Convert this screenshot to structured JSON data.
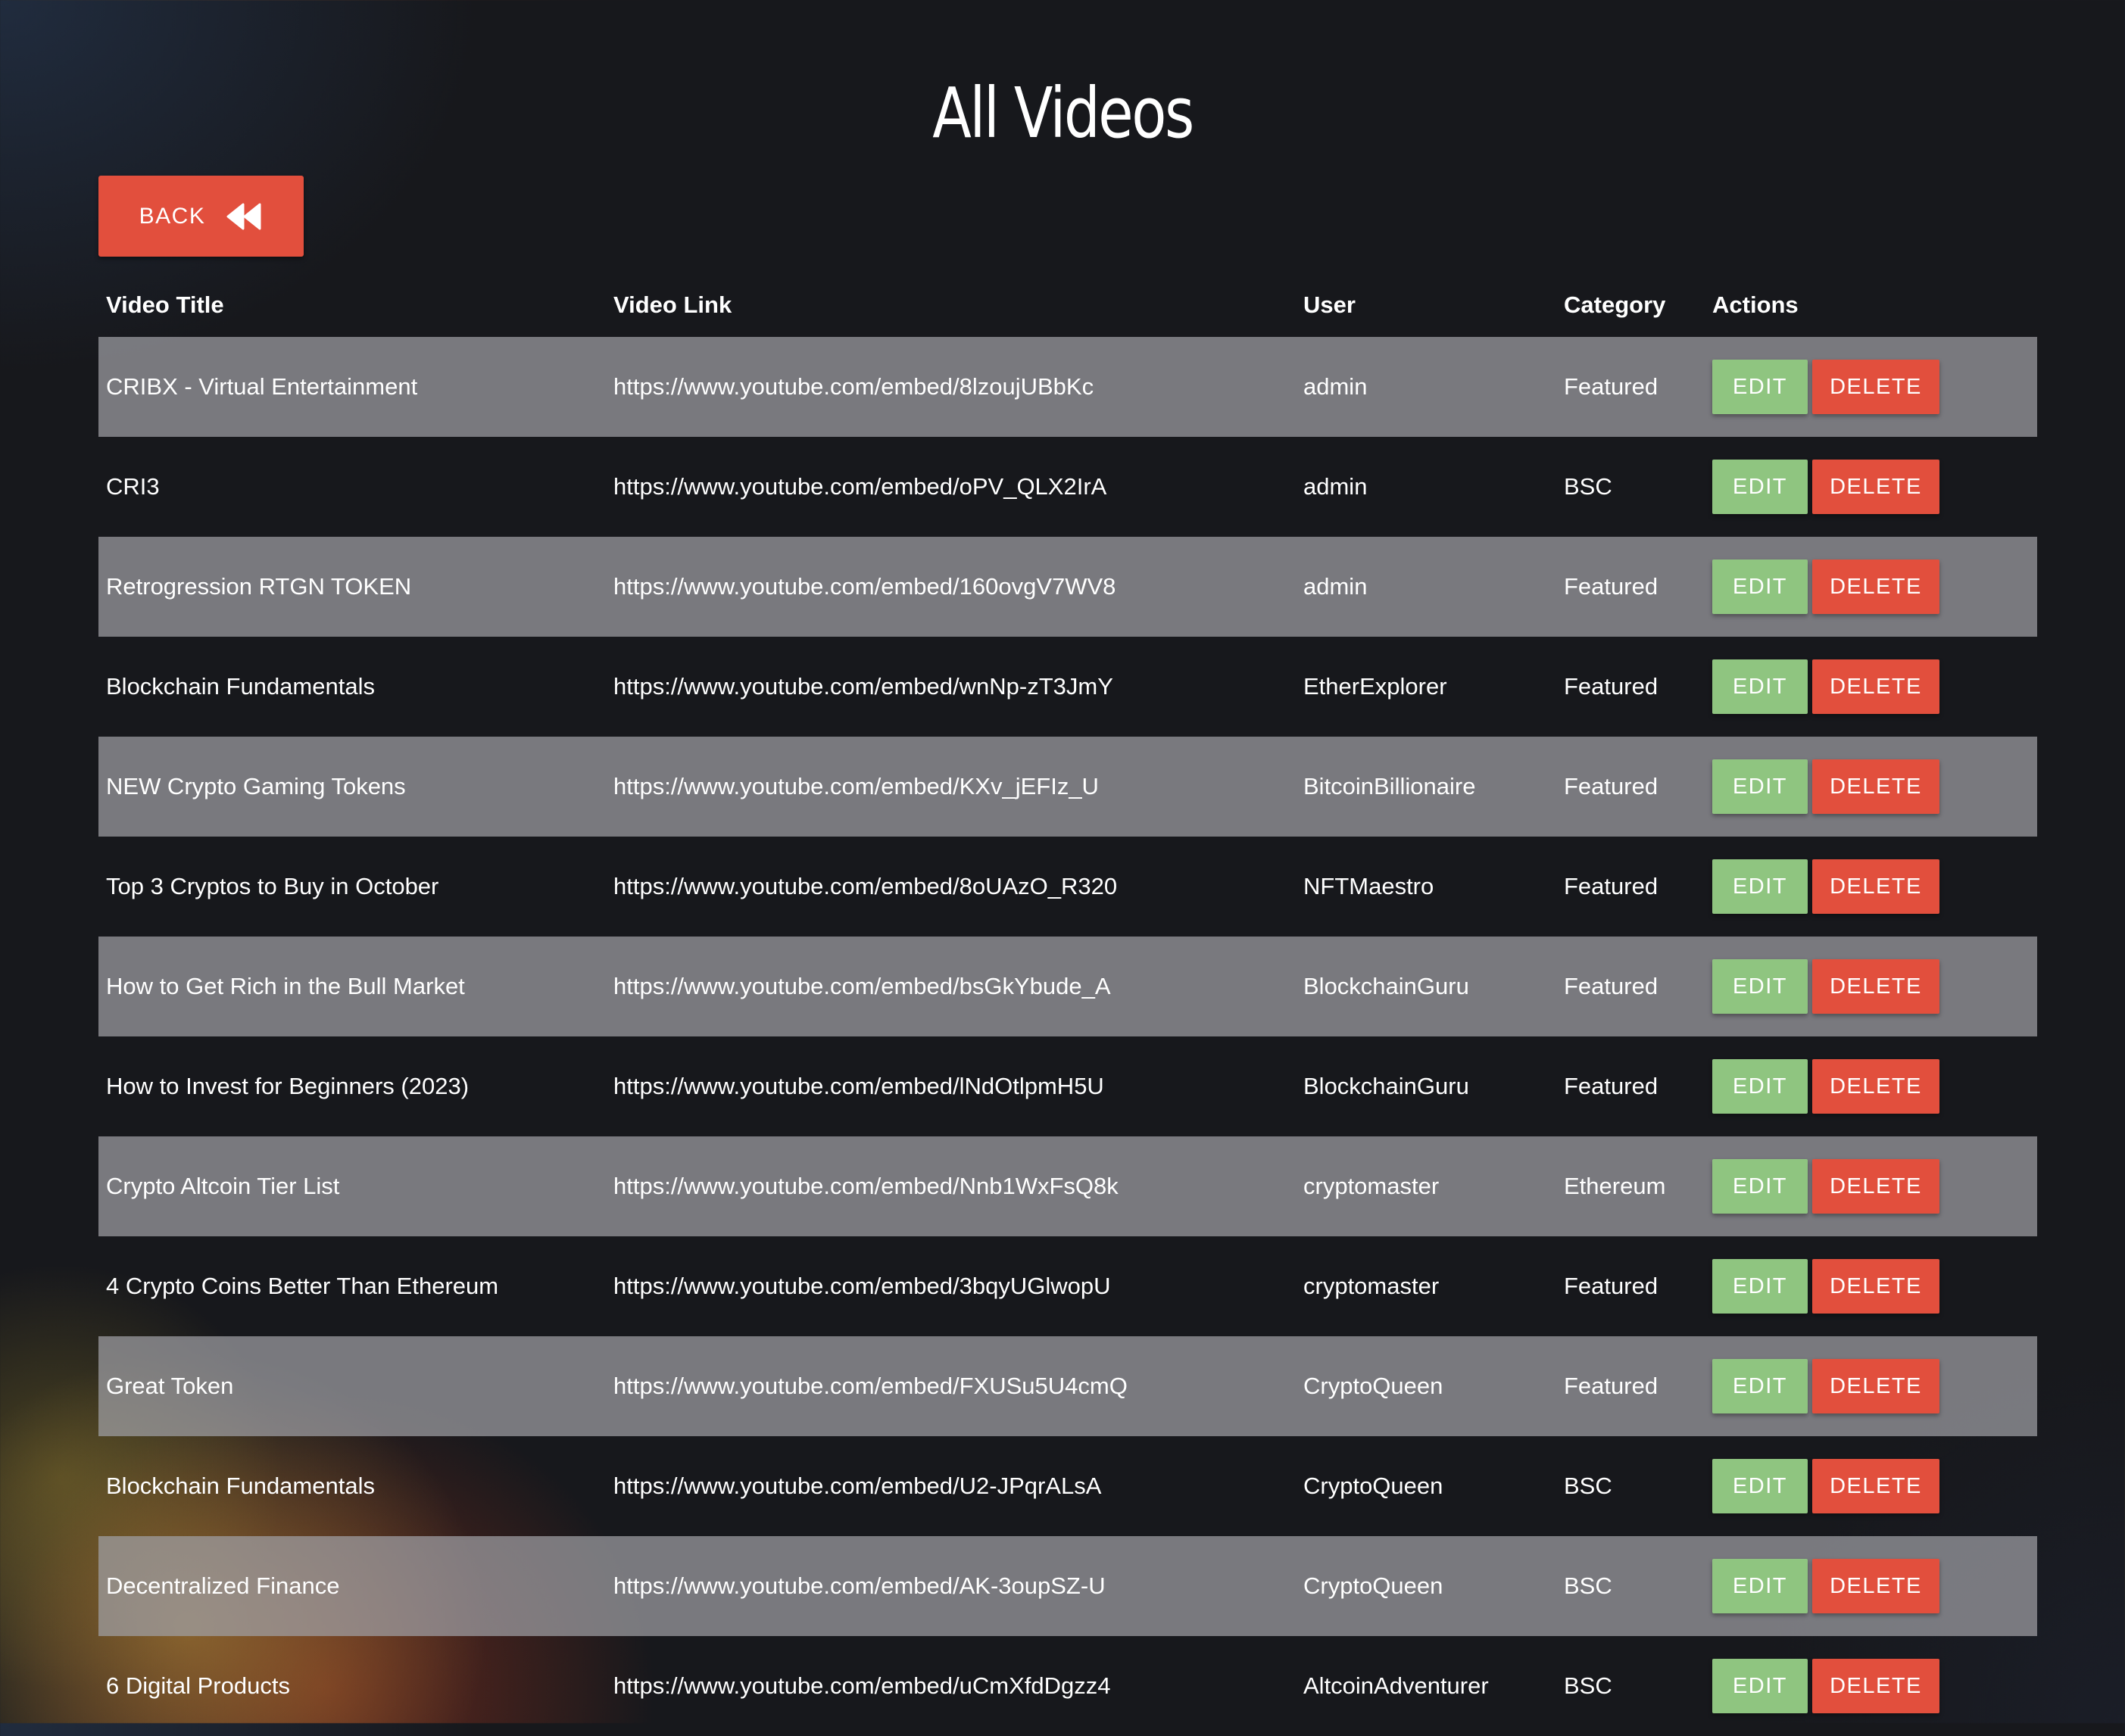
{
  "page_title": "All Videos",
  "back_button": {
    "label": "BACK"
  },
  "table": {
    "headers": {
      "title": "Video Title",
      "link": "Video Link",
      "user": "User",
      "category": "Category",
      "actions": "Actions"
    },
    "edit_label": "EDIT",
    "delete_label": "DELETE",
    "rows": [
      {
        "title": "CRIBX - Virtual Entertainment",
        "link": "https://www.youtube.com/embed/8lzoujUBbKc",
        "user": "admin",
        "category": "Featured"
      },
      {
        "title": "CRI3",
        "link": "https://www.youtube.com/embed/oPV_QLX2IrA",
        "user": "admin",
        "category": "BSC"
      },
      {
        "title": "Retrogression RTGN TOKEN",
        "link": "https://www.youtube.com/embed/160ovgV7WV8",
        "user": "admin",
        "category": "Featured"
      },
      {
        "title": "Blockchain Fundamentals",
        "link": "https://www.youtube.com/embed/wnNp-zT3JmY",
        "user": "EtherExplorer",
        "category": "Featured"
      },
      {
        "title": "NEW Crypto Gaming Tokens",
        "link": "https://www.youtube.com/embed/KXv_jEFIz_U",
        "user": "BitcoinBillionaire",
        "category": "Featured"
      },
      {
        "title": "Top 3 Cryptos to Buy in October",
        "link": "https://www.youtube.com/embed/8oUAzO_R320",
        "user": "NFTMaestro",
        "category": "Featured"
      },
      {
        "title": "How to Get Rich in the Bull Market",
        "link": "https://www.youtube.com/embed/bsGkYbude_A",
        "user": "BlockchainGuru",
        "category": "Featured"
      },
      {
        "title": "How to Invest for Beginners (2023)",
        "link": "https://www.youtube.com/embed/lNdOtlpmH5U",
        "user": "BlockchainGuru",
        "category": "Featured"
      },
      {
        "title": "Crypto Altcoin Tier List",
        "link": "https://www.youtube.com/embed/Nnb1WxFsQ8k",
        "user": "cryptomaster",
        "category": "Ethereum"
      },
      {
        "title": "4 Crypto Coins Better Than Ethereum",
        "link": "https://www.youtube.com/embed/3bqyUGlwopU",
        "user": "cryptomaster",
        "category": "Featured"
      },
      {
        "title": "Great Token",
        "link": "https://www.youtube.com/embed/FXUSu5U4cmQ",
        "user": "CryptoQueen",
        "category": "Featured"
      },
      {
        "title": "Blockchain Fundamentals",
        "link": "https://www.youtube.com/embed/U2-JPqrALsA",
        "user": "CryptoQueen",
        "category": "BSC"
      },
      {
        "title": "Decentralized Finance",
        "link": "https://www.youtube.com/embed/AK-3oupSZ-U",
        "user": "CryptoQueen",
        "category": "BSC"
      },
      {
        "title": "6 Digital Products",
        "link": "https://www.youtube.com/embed/uCmXfdDgzz4",
        "user": "AltcoinAdventurer",
        "category": "BSC"
      }
    ]
  },
  "icons": {
    "back": "fast-backward-icon"
  },
  "colors": {
    "danger": "#e24f3d",
    "success": "#8fc580",
    "row_stripe": "#a0a0a5"
  }
}
